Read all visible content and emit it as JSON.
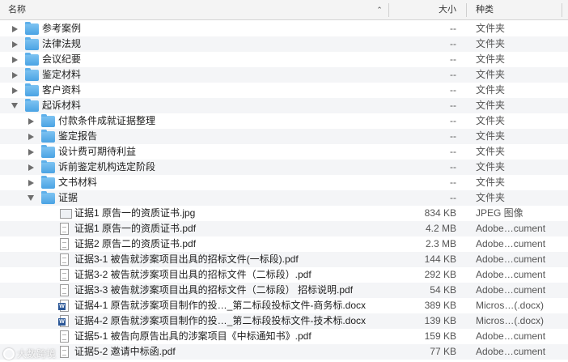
{
  "header": {
    "name": "名称",
    "size": "大小",
    "kind": "种类",
    "sort_indicator": "⌃"
  },
  "rows": [
    {
      "level": 0,
      "disclosure": "collapsed",
      "icon": "folder-icon",
      "name": "参考案例",
      "size": "--",
      "kind": "文件夹"
    },
    {
      "level": 0,
      "disclosure": "collapsed",
      "icon": "folder-icon",
      "name": "法律法规",
      "size": "--",
      "kind": "文件夹"
    },
    {
      "level": 0,
      "disclosure": "collapsed",
      "icon": "folder-icon",
      "name": "会议纪要",
      "size": "--",
      "kind": "文件夹"
    },
    {
      "level": 0,
      "disclosure": "collapsed",
      "icon": "folder-icon",
      "name": "鉴定材料",
      "size": "--",
      "kind": "文件夹"
    },
    {
      "level": 0,
      "disclosure": "collapsed",
      "icon": "folder-icon",
      "name": "客户资料",
      "size": "--",
      "kind": "文件夹"
    },
    {
      "level": 0,
      "disclosure": "expanded",
      "icon": "folder-icon",
      "name": "起诉材料",
      "size": "--",
      "kind": "文件夹"
    },
    {
      "level": 1,
      "disclosure": "collapsed",
      "icon": "folder-icon",
      "name": "付款条件成就证据整理",
      "size": "--",
      "kind": "文件夹"
    },
    {
      "level": 1,
      "disclosure": "collapsed",
      "icon": "folder-icon",
      "name": "鉴定报告",
      "size": "--",
      "kind": "文件夹"
    },
    {
      "level": 1,
      "disclosure": "collapsed",
      "icon": "folder-icon",
      "name": "设计费可期待利益",
      "size": "--",
      "kind": "文件夹"
    },
    {
      "level": 1,
      "disclosure": "collapsed",
      "icon": "folder-icon",
      "name": "诉前鉴定机构选定阶段",
      "size": "--",
      "kind": "文件夹"
    },
    {
      "level": 1,
      "disclosure": "collapsed",
      "icon": "folder-icon",
      "name": "文书材料",
      "size": "--",
      "kind": "文件夹"
    },
    {
      "level": 1,
      "disclosure": "expanded",
      "icon": "folder-icon",
      "name": "证据",
      "size": "--",
      "kind": "文件夹"
    },
    {
      "level": 2,
      "disclosure": "none",
      "icon": "image-file-icon",
      "name": "证据1 原告一的资质证书.jpg",
      "size": "834 KB",
      "kind": "JPEG 图像"
    },
    {
      "level": 2,
      "disclosure": "none",
      "icon": "pdf-file-icon",
      "name": "证据1 原告一的资质证书.pdf",
      "size": "4.2 MB",
      "kind": "Adobe…cument"
    },
    {
      "level": 2,
      "disclosure": "none",
      "icon": "pdf-file-icon",
      "name": "证据2 原告二的资质证书.pdf",
      "size": "2.3 MB",
      "kind": "Adobe…cument"
    },
    {
      "level": 2,
      "disclosure": "none",
      "icon": "pdf-file-icon",
      "name": "证据3-1 被告就涉案项目出具的招标文件(一标段).pdf",
      "size": "144 KB",
      "kind": "Adobe…cument"
    },
    {
      "level": 2,
      "disclosure": "none",
      "icon": "pdf-file-icon",
      "name": "证据3-2 被告就涉案项目出具的招标文件（二标段）.pdf",
      "size": "292 KB",
      "kind": "Adobe…cument"
    },
    {
      "level": 2,
      "disclosure": "none",
      "icon": "pdf-file-icon",
      "name": "证据3-3 被告就涉案项目出具的招标文件（二标段） 招标说明.pdf",
      "size": "54 KB",
      "kind": "Adobe…cument"
    },
    {
      "level": 2,
      "disclosure": "none",
      "icon": "word-file-icon",
      "name": "证据4-1 原告就涉案项目制作的投…_第二标段投标文件-商务标.docx",
      "size": "389 KB",
      "kind": "Micros…(.docx)"
    },
    {
      "level": 2,
      "disclosure": "none",
      "icon": "word-file-icon",
      "name": "证据4-2 原告就涉案项目制作的投…_第二标段投标文件-技术标.docx",
      "size": "139 KB",
      "kind": "Micros…(.docx)"
    },
    {
      "level": 2,
      "disclosure": "none",
      "icon": "pdf-file-icon",
      "name": "证据5-1 被告向原告出具的涉案项目《中标通知书》.pdf",
      "size": "159 KB",
      "kind": "Adobe…cument"
    },
    {
      "level": 2,
      "disclosure": "none",
      "icon": "pdf-file-icon",
      "name": "证据5-2 邀请中标函.pdf",
      "size": "77 KB",
      "kind": "Adobe…cument"
    }
  ],
  "watermark": {
    "text": "大数跨境"
  }
}
